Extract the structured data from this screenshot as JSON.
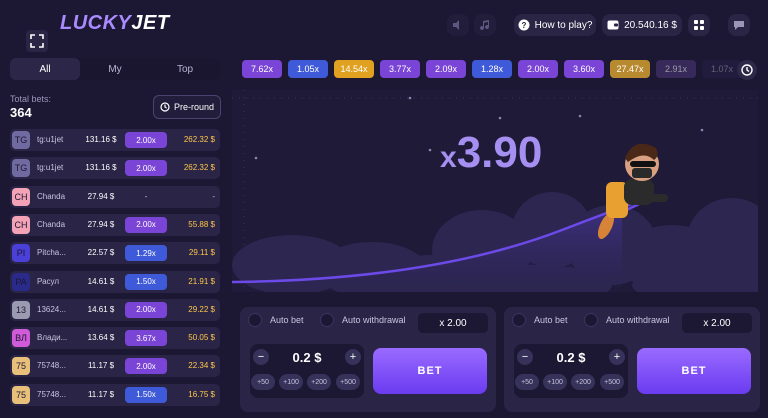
{
  "header": {
    "logo_part1": "LUCKY",
    "logo_part2": "JET",
    "how_to_play": "How to play?",
    "balance": "20.540.16 $"
  },
  "left": {
    "tabs": [
      "All",
      "My",
      "Top"
    ],
    "total_bets_label": "Total bets:",
    "total_bets_value": "364",
    "preround_label": "Pre-round",
    "bets": [
      {
        "initials": "TG",
        "name": "tg:u1jet",
        "amount": "131.16 $",
        "mult": "2.00x",
        "win": "262.32 $",
        "avatar_color": "#6f6aa0",
        "mult_color": "#7a45d6"
      },
      {
        "initials": "TG",
        "name": "tg:u1jet",
        "amount": "131.16 $",
        "mult": "2.00x",
        "win": "262.32 $",
        "avatar_color": "#6f6aa0",
        "mult_color": "#7a45d6"
      },
      {
        "initials": "CH",
        "name": "Chanda",
        "amount": "27.94 $",
        "mult": "-",
        "win": "-",
        "avatar_color": "#f4a3b6",
        "mult_color": "transparent"
      },
      {
        "initials": "CH",
        "name": "Chanda",
        "amount": "27.94 $",
        "mult": "2.00x",
        "win": "55.88 $",
        "avatar_color": "#f4a3b6",
        "mult_color": "#7a45d6"
      },
      {
        "initials": "PI",
        "name": "Pitcha...",
        "amount": "22.57 $",
        "mult": "1.29x",
        "win": "29.11 $",
        "avatar_color": "#4a3fd6",
        "mult_color": "#3f5ad8"
      },
      {
        "initials": "PA",
        "name": "Расул",
        "amount": "14.61 $",
        "mult": "1.50x",
        "win": "21.91 $",
        "avatar_color": "#2a2a8a",
        "mult_color": "#3f5ad8"
      },
      {
        "initials": "13",
        "name": "13624...",
        "amount": "14.61 $",
        "mult": "2.00x",
        "win": "29.22 $",
        "avatar_color": "#9a9ab0",
        "mult_color": "#7a45d6"
      },
      {
        "initials": "ВЛ",
        "name": "Влади...",
        "amount": "13.64 $",
        "mult": "3.67x",
        "win": "50.05 $",
        "avatar_color": "#d05ad8",
        "mult_color": "#7a45d6"
      },
      {
        "initials": "75",
        "name": "75748...",
        "amount": "11.17 $",
        "mult": "2.00x",
        "win": "22.34 $",
        "avatar_color": "#e8c07a",
        "mult_color": "#7a45d6"
      },
      {
        "initials": "75",
        "name": "75748...",
        "amount": "11.17 $",
        "mult": "1.50x",
        "win": "16.75 $",
        "avatar_color": "#e8c07a",
        "mult_color": "#3f5ad8"
      }
    ]
  },
  "history": [
    {
      "value": "7.62x",
      "color": "#7a45d6"
    },
    {
      "value": "1.05x",
      "color": "#3f5ad8"
    },
    {
      "value": "14.54x",
      "color": "#e0a020"
    },
    {
      "value": "3.77x",
      "color": "#7a45d6"
    },
    {
      "value": "2.09x",
      "color": "#7a45d6"
    },
    {
      "value": "1.28x",
      "color": "#3f5ad8"
    },
    {
      "value": "2.00x",
      "color": "#7a45d6"
    },
    {
      "value": "3.60x",
      "color": "#7a45d6"
    },
    {
      "value": "27.47x",
      "color": "#b88a30"
    },
    {
      "value": "2.91x",
      "color": "#4e3a7a"
    },
    {
      "value": "1.07x",
      "color": "#2e2a58"
    }
  ],
  "game": {
    "multiplier_prefix": "x",
    "multiplier_value": "3.90"
  },
  "panels": [
    {
      "auto_bet": "Auto bet",
      "auto_withdrawal": "Auto withdrawal",
      "withdraw_mult": "x 2.00",
      "stake": "0.2 $",
      "quick": [
        "+50",
        "+100",
        "+200",
        "+500"
      ],
      "bet_label": "BET"
    },
    {
      "auto_bet": "Auto bet",
      "auto_withdrawal": "Auto withdrawal",
      "withdraw_mult": "x 2.00",
      "stake": "0.2 $",
      "quick": [
        "+50",
        "+100",
        "+200",
        "+500"
      ],
      "bet_label": "BET"
    }
  ]
}
